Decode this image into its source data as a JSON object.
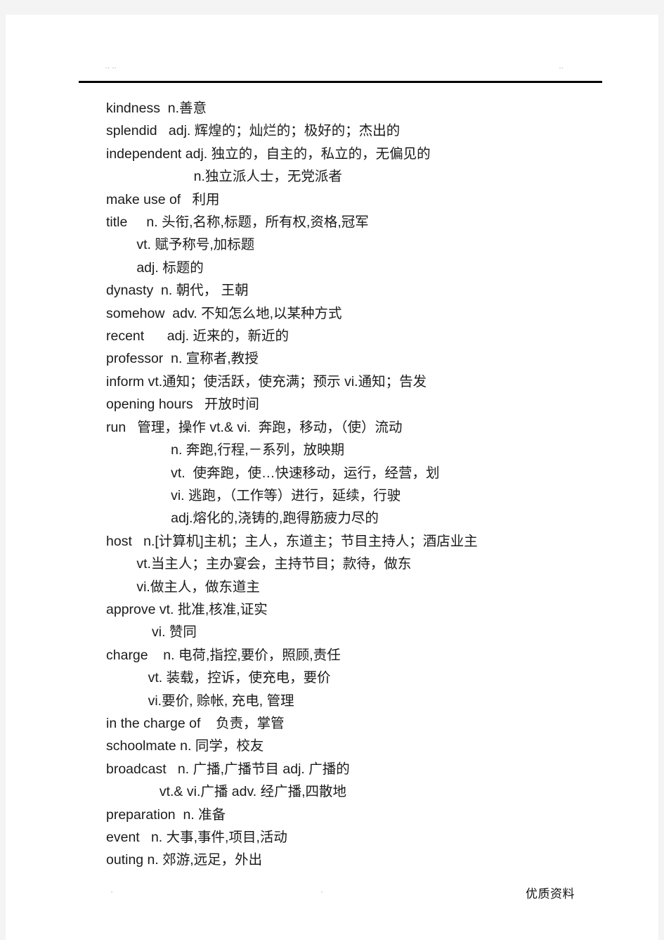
{
  "header": {
    "left_mark": "-- --",
    "right_mark": "--"
  },
  "document": {
    "lines": [
      "kindness  n.善意",
      "splendid   adj. 辉煌的；灿烂的；极好的；杰出的",
      "independent adj. 独立的，自主的，私立的，无偏见的",
      "                       n.独立派人士，无党派者",
      "make use of   利用",
      "title     n. 头衔,名称,标题，所有权,资格,冠军",
      "        vt. 赋予称号,加标题",
      "        adj. 标题的",
      "dynasty  n. 朝代， 王朝",
      "somehow  adv. 不知怎么地,以某种方式",
      "recent      adj. 近来的，新近的",
      "professor  n. 宣称者,教授",
      "inform vt.通知；使活跃，使充满；预示 vi.通知；告发",
      "opening hours   开放时间",
      "run   管理，操作 vt.& vi.  奔跑，移动，（使）流动",
      "                 n. 奔跑,行程,－系列，放映期",
      "                 vt.  使奔跑，使…快速移动，运行，经营，划",
      "                 vi. 逃跑，（工作等）进行，延续，行驶",
      "                 adj.熔化的,浇铸的,跑得筋疲力尽的",
      "host   n.[计算机]主机；主人，东道主；节目主持人；酒店业主",
      "        vt.当主人；主办宴会，主持节目；款待，做东",
      "        vi.做主人，做东道主",
      "approve vt. 批准,核准,证实",
      "            vi. 赞同",
      "charge    n. 电荷,指控,要价，照顾,责任",
      "           vt. 装载，控诉，使充电，要价",
      "           vi.要价, 赊帐, 充电, 管理",
      "in the charge of    负责，掌管",
      "schoolmate n. 同学，校友",
      "broadcast   n. 广播,广播节目 adj. 广播的",
      "              vt.& vi.广播 adv. 经广播,四散地",
      "preparation  n. 准备",
      "event   n. 大事,事件,项目,活动",
      "outing n. 郊游,远足，外出"
    ]
  },
  "footer": {
    "mark_left": "-",
    "mark_center": "-",
    "watermark": "优质资料"
  }
}
